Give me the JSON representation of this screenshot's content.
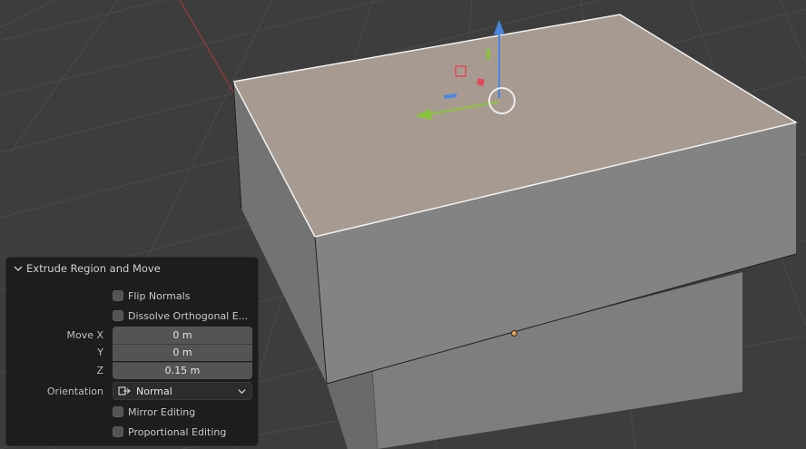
{
  "viewport": {
    "background_color": "#3d3d3d",
    "top_face_color": "#a79b91",
    "side_face_color": "#7b7b7b",
    "front_face_color": "#858585",
    "gizmo_colors": {
      "x": "#e24a5a",
      "y": "#8ac43a",
      "z": "#4a86e0"
    }
  },
  "operator_panel": {
    "title": "Extrude Region and Move",
    "flip_normals": {
      "label": "Flip Normals",
      "checked": false
    },
    "dissolve_orthogonal": {
      "label": "Dissolve Orthogonal E...",
      "checked": false
    },
    "move": {
      "x_label": "Move X",
      "x_value": "0 m",
      "y_label": "Y",
      "y_value": "0 m",
      "z_label": "Z",
      "z_value": "0.15 m"
    },
    "orientation": {
      "label": "Orientation",
      "value": "Normal",
      "icon": "orientation-normal-icon"
    },
    "mirror_editing": {
      "label": "Mirror Editing",
      "checked": false
    },
    "proportional_editing": {
      "label": "Proportional Editing",
      "checked": false
    }
  }
}
